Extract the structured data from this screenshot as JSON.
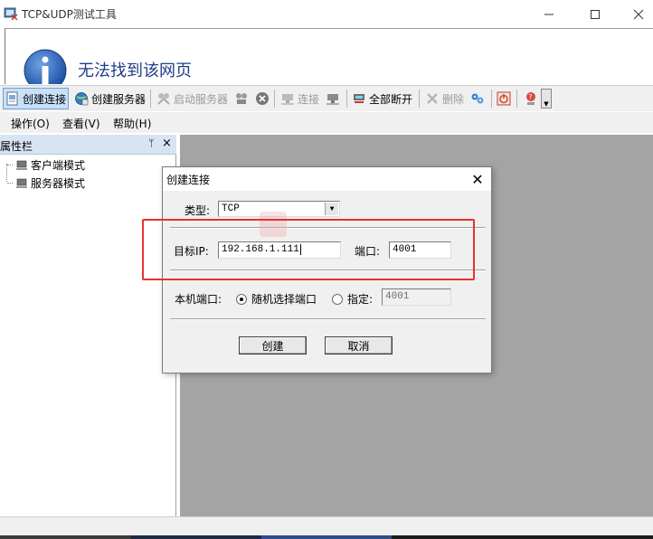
{
  "window": {
    "title": "TCP&UDP测试工具",
    "controls": [
      "minimize",
      "maximize",
      "close"
    ]
  },
  "webpage": {
    "error_text": "无法找到该网页",
    "icon": "info-icon"
  },
  "toolbar": {
    "items": [
      {
        "label": "创建连接",
        "icon": "create-connection-icon",
        "state": "active"
      },
      {
        "label": "创建服务器",
        "icon": "create-server-icon",
        "state": "enabled"
      },
      {
        "label": "启动服务器",
        "icon": "start-server-icon",
        "state": "disabled"
      },
      {
        "label": "",
        "icon": "stop-server-icon",
        "state": "disabled"
      },
      {
        "label": "",
        "icon": "delete-circle-icon",
        "state": "disabled"
      },
      {
        "label": "连接",
        "icon": "connect-icon",
        "state": "disabled"
      },
      {
        "label": "",
        "icon": "disconnect-icon",
        "state": "disabled"
      },
      {
        "label": "全部断开",
        "icon": "disconnect-all-icon",
        "state": "enabled"
      },
      {
        "label": "删除",
        "icon": "delete-icon",
        "state": "disabled"
      },
      {
        "label": "",
        "icon": "settings-icon",
        "state": "enabled"
      },
      {
        "label": "",
        "icon": "power-icon",
        "state": "enabled"
      },
      {
        "label": "",
        "icon": "about-icon",
        "state": "enabled"
      }
    ]
  },
  "menubar": {
    "items": [
      "操作(O)",
      "查看(V)",
      "帮助(H)"
    ]
  },
  "side_panel": {
    "title": "属性栏",
    "pin": "ᛘ",
    "close": "×",
    "tree": [
      "客户端模式",
      "服务器模式"
    ]
  },
  "dialog": {
    "title": "创建连接",
    "close": "✕",
    "type_label": "类型:",
    "type_value": "TCP",
    "target_ip_label": "目标IP:",
    "target_ip_value": "192.168.1.111",
    "port_label": "端口:",
    "port_value": "4001",
    "local_port_label": "本机端口:",
    "random_port_label": "随机选择端口",
    "random_port_checked": true,
    "specify_label": "指定:",
    "specify_checked": false,
    "specify_value": "4001",
    "create_button": "创建",
    "cancel_button": "取消"
  },
  "colors": {
    "highlight": "#e53232",
    "main_area": "#a4a4a4",
    "panel_header": "#d7e4f2",
    "web_error_text": "#1f3c87"
  }
}
